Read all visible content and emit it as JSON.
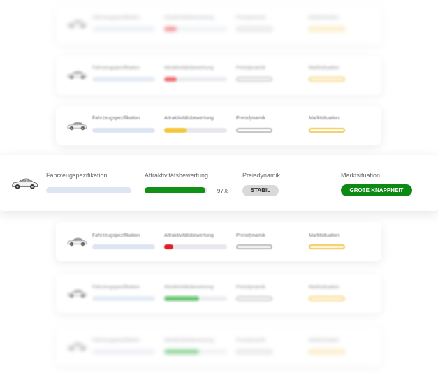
{
  "labels": {
    "spec": "Fahrzeugspezifikation",
    "attr": "Attraktivitätsbewertung",
    "price": "Preisdynamik",
    "market": "Marktsituation"
  },
  "highlight": {
    "attractiveness_percent": "97%",
    "attractiveness_fill": 0.97,
    "price_status": "STABIL",
    "market_status": "GROßE KNAPPHEIT"
  },
  "rows": [
    {
      "attractiveness_fill": 0.2,
      "attr_color": "#e8434b",
      "market_color": "yellow"
    },
    {
      "attractiveness_fill": 0.2,
      "attr_color": "#e8434b",
      "market_color": "yellow"
    },
    {
      "attractiveness_fill": 0.35,
      "attr_color": "#f6c73c",
      "market_color": "yellow"
    },
    {
      "attractiveness_fill": 0.14,
      "attr_color": "#e02025",
      "market_color": "yellow"
    },
    {
      "attractiveness_fill": 0.55,
      "attr_color": "#3bb34a",
      "market_color": "yellow"
    },
    {
      "attractiveness_fill": 0.55,
      "attr_color": "#3bb34a",
      "market_color": "yellow"
    }
  ],
  "colors": {
    "spec_bar": "#dde5f2",
    "attr_green": "#109116",
    "badge_green": "#0e8a14"
  },
  "icons": [
    "car-icon"
  ]
}
